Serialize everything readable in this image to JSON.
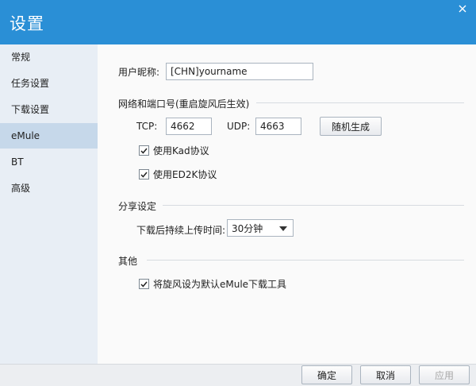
{
  "window": {
    "title": "设置"
  },
  "sidebar": {
    "items": [
      {
        "label": "常规"
      },
      {
        "label": "任务设置"
      },
      {
        "label": "下载设置"
      },
      {
        "label": "eMule"
      },
      {
        "label": "BT"
      },
      {
        "label": "高级"
      }
    ],
    "active": "eMule"
  },
  "user": {
    "nickname_label": "用户昵称:",
    "nickname_value": "[CHN]yourname"
  },
  "network": {
    "section_title": "网络和端口号(重启旋风后生效)",
    "tcp_label": "TCP:",
    "tcp_value": "4662",
    "udp_label": "UDP:",
    "udp_value": "4663",
    "random_button": "随机生成",
    "kad_label": "使用Kad协议",
    "kad_checked": true,
    "ed2k_label": "使用ED2K协议",
    "ed2k_checked": true
  },
  "share": {
    "section_title": "分享设定",
    "duration_label": "下载后持续上传时间:",
    "duration_value": "30分钟"
  },
  "other": {
    "section_title": "其他",
    "default_tool_label": "将旋风设为默认eMule下载工具",
    "default_tool_checked": true
  },
  "footer": {
    "ok": "确定",
    "cancel": "取消",
    "apply": "应用"
  },
  "colors": {
    "titlebar": "#2a8fd6",
    "sidebar_bg": "#e8eef5",
    "sidebar_active": "#c6d8ea"
  },
  "icons": {
    "close": "close-icon",
    "check": "checkmark-icon",
    "dropdown": "chevron-down-icon"
  }
}
